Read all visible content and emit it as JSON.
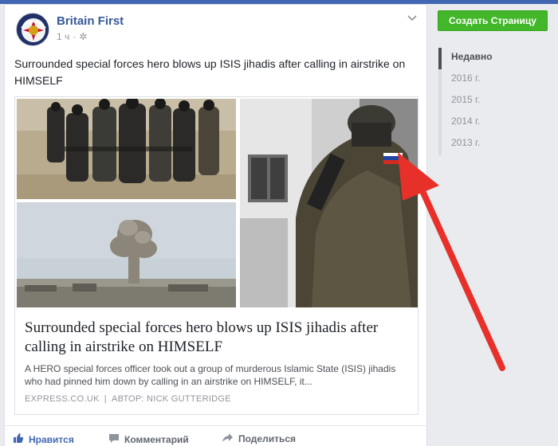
{
  "post": {
    "page_name": "Britain First",
    "time": "1 ч",
    "privacy_icon": "settings-cog-icon",
    "text": "Surrounded special forces hero blows up ISIS jihadis after calling in airstrike on HIMSELF",
    "link": {
      "title": "Surrounded special forces hero blows up ISIS jihadis after calling in airstrike on HIMSELF",
      "description": "A HERO special forces officer took out a group of murderous Islamic State (ISIS) jihadis who had pinned him down by calling in an airstrike on HIMSELF, it...",
      "domain": "EXPRESS.CO.UK",
      "separator": "|",
      "author": "АВТОР: NICK GUTTERIDGE"
    },
    "actions": {
      "like": "Нравится",
      "comment": "Комментарий",
      "share": "Поделиться"
    }
  },
  "sidebar": {
    "create_page": "Создать Страницу",
    "timeline": [
      {
        "label": "Недавно"
      },
      {
        "label": "2016 г."
      },
      {
        "label": "2015 г."
      },
      {
        "label": "2014 г."
      },
      {
        "label": "2013 г."
      }
    ]
  },
  "colors": {
    "link_blue": "#365899",
    "create_green": "#42b72a",
    "annotation_red": "#e8302a"
  }
}
